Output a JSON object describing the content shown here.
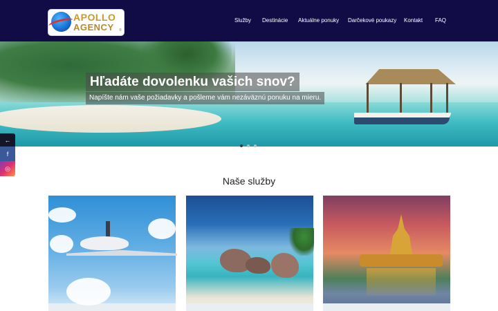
{
  "brand": {
    "line1": "APOLLO",
    "line2": "AGENCY",
    "mark": "®",
    "colors": {
      "header_bg": "#120c46",
      "logo_gold": "#c79a2c"
    }
  },
  "nav": {
    "items": [
      "Služby",
      "Destinácie",
      "Aktuálne ponuky",
      "Darčekové poukazy",
      "Kontakt",
      "FAQ"
    ]
  },
  "hero": {
    "title": "Hľadáte dovolenku vašich snov?",
    "subtitle": "Napíšte nám vaše požiadavky a pošleme vám nezáväznú ponuku na mieru.",
    "slides_total": 3,
    "active_slide": 1
  },
  "social": {
    "items": [
      {
        "icon": "arrow-left-icon",
        "glyph": "←"
      },
      {
        "icon": "facebook-icon",
        "glyph": "f"
      },
      {
        "icon": "instagram-icon",
        "glyph": "◎"
      }
    ]
  },
  "services": {
    "title": "Naše služby",
    "cards": [
      {
        "image": "airplane-sky"
      },
      {
        "image": "tropical-beach-rocks"
      },
      {
        "image": "golden-pagoda-lake"
      }
    ]
  }
}
